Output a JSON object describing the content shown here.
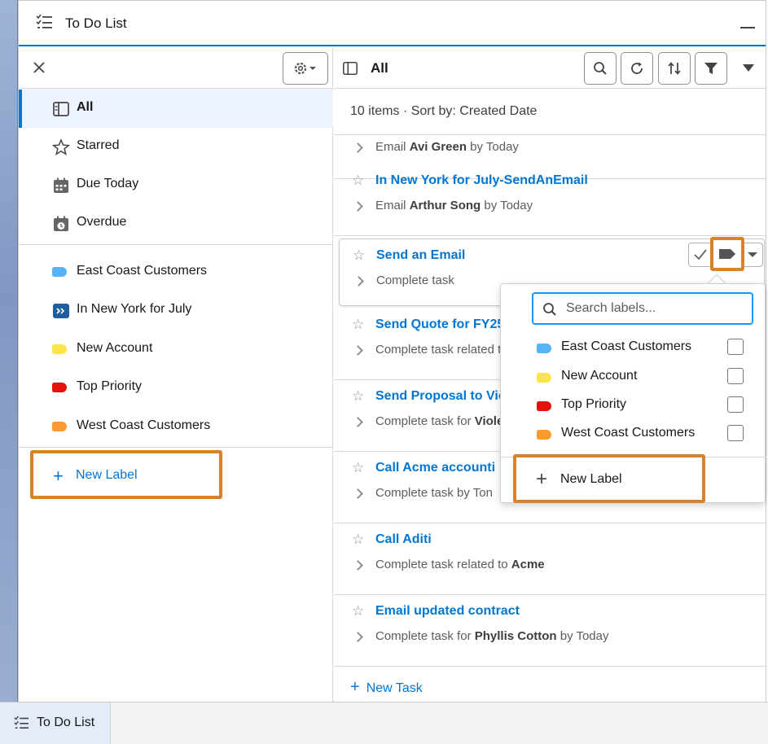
{
  "window": {
    "title": "To Do List",
    "title_icon": "task-list-icon",
    "accent_color": "#0176d3"
  },
  "left_nav": {
    "views": [
      {
        "label": "All",
        "icon": "list-view-icon",
        "active": true
      },
      {
        "label": "Starred",
        "icon": "star-icon"
      },
      {
        "label": "Due Today",
        "icon": "calendar-icon"
      },
      {
        "label": "Overdue",
        "icon": "calendar-clock-icon"
      }
    ],
    "labels": [
      {
        "label": "East Coast Customers",
        "color": "#56b4f5",
        "icon": "tag-icon"
      },
      {
        "label": "In New York for July",
        "color": "#1f5f9f",
        "icon": "forward-tag-icon"
      },
      {
        "label": "New Account",
        "color": "#fde44b",
        "icon": "tag-icon"
      },
      {
        "label": "Top Priority",
        "color": "#e3120b",
        "icon": "tag-icon"
      },
      {
        "label": "West Coast Customers",
        "color": "#f99a31",
        "icon": "tag-icon"
      }
    ],
    "new_label": "New Label"
  },
  "list": {
    "title": "All",
    "subheader": "10 items · Sort by: Created Date",
    "partial_task": {
      "desc_pre": "Email ",
      "desc_bold": "Avi Green",
      "desc_post": " by Today"
    },
    "tasks": [
      {
        "title": "In New York for July-SendAnEmail",
        "desc_pre": "Email ",
        "desc_bold": "Arthur Song",
        "desc_post": " by Today"
      },
      {
        "title": "Send an Email",
        "desc_pre": "Complete task",
        "desc_bold": "",
        "desc_post": ""
      },
      {
        "title": "Send Quote for FY25",
        "desc_pre": "Complete task related to",
        "desc_bold": "",
        "desc_post": ""
      },
      {
        "title": "Send Proposal to Viole",
        "desc_pre": "Complete task for ",
        "desc_bold": "Violet",
        "desc_post": ""
      },
      {
        "title": "Call Acme accounti",
        "desc_pre": "Complete task by Ton",
        "desc_bold": "",
        "desc_post": ""
      },
      {
        "title": "Call Aditi",
        "desc_pre": "Complete task related to ",
        "desc_bold": "Acme",
        "desc_post": ""
      },
      {
        "title": "Email updated contract",
        "desc_pre": "Complete task for ",
        "desc_bold": "Phyllis Cotton",
        "desc_post": " by Today"
      }
    ],
    "new_task": "New Task"
  },
  "label_popover": {
    "search_placeholder": "Search labels...",
    "items": [
      {
        "label": "East Coast Customers",
        "color": "#56b4f5"
      },
      {
        "label": "New Account",
        "color": "#fde44b"
      },
      {
        "label": "Top Priority",
        "color": "#e3120b"
      },
      {
        "label": "West Coast Customers",
        "color": "#f99a31"
      }
    ],
    "new_label": "New Label"
  },
  "utility_bar": {
    "tab_label": "To Do List"
  },
  "highlight_color": "#d9822b"
}
